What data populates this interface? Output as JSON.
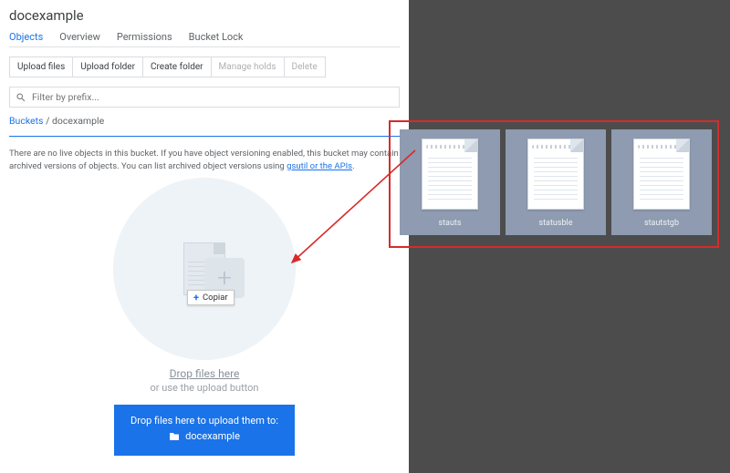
{
  "title": "docexample",
  "tabs": [
    "Objects",
    "Overview",
    "Permissions",
    "Bucket Lock"
  ],
  "active_tab_index": 0,
  "toolbar": {
    "upload_files": "Upload files",
    "upload_folder": "Upload folder",
    "create_folder": "Create folder",
    "manage_holds": "Manage holds",
    "delete": "Delete"
  },
  "filter": {
    "placeholder": "Filter by prefix..."
  },
  "breadcrumb": {
    "root": "Buckets",
    "sep": " / ",
    "current": "docexample"
  },
  "empty": {
    "line": "There are no live objects in this bucket. If you have object versioning enabled, this bucket may contain archived versions of objects. You can list archived object versions using ",
    "link": "gsutil or the APIs"
  },
  "copiar_tooltip": "Copiar",
  "drop": {
    "main": "Drop files here",
    "sub": "or use the upload button"
  },
  "banner": {
    "line1": "Drop files here to upload them to:",
    "bucket": "docexample"
  },
  "desktop_files": [
    "stauts",
    "statusble",
    "stautstgb"
  ]
}
